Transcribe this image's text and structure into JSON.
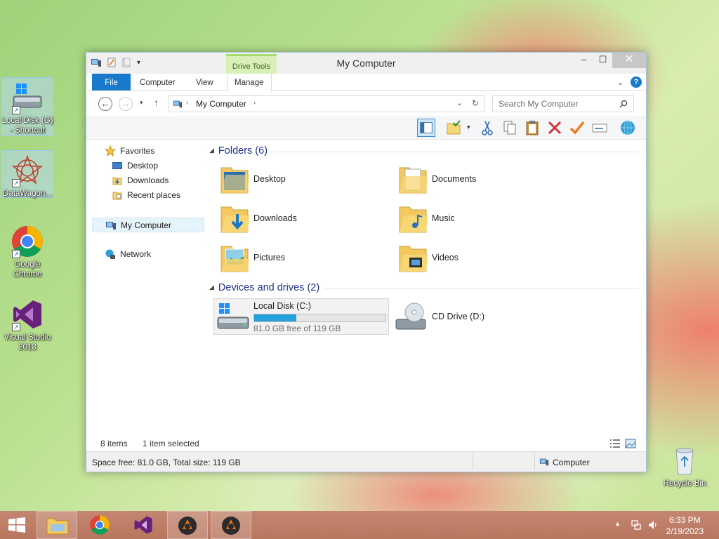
{
  "desktop": {
    "icons": [
      {
        "label_line1": "Local Disk (G)",
        "label_line2": "- Shortcut"
      },
      {
        "label_line1": "DataWagon...",
        "label_line2": ""
      },
      {
        "label_line1": "Google",
        "label_line2": "Chrome"
      },
      {
        "label_line1": "Visual Studio",
        "label_line2": "2013"
      },
      {
        "label_line1": "Recycle Bin",
        "label_line2": ""
      }
    ]
  },
  "window": {
    "title": "My Computer",
    "context_tab": "Drive Tools",
    "controls": {
      "minimize": "–",
      "maximize": "☐",
      "close": "✕"
    },
    "tabs": [
      {
        "label": "File"
      },
      {
        "label": "Computer"
      },
      {
        "label": "View"
      },
      {
        "label": "Manage"
      }
    ],
    "help": "?",
    "address": {
      "path": "My Computer"
    },
    "search": {
      "placeholder": "Search My Computer"
    },
    "nav": {
      "favorites": "Favorites",
      "items": [
        {
          "label": "Desktop"
        },
        {
          "label": "Downloads"
        },
        {
          "label": "Recent places"
        }
      ],
      "my_computer": "My Computer",
      "network": "Network"
    },
    "folders": {
      "heading": "Folders (6)",
      "items": [
        {
          "name": "Desktop"
        },
        {
          "name": "Documents"
        },
        {
          "name": "Downloads"
        },
        {
          "name": "Music"
        },
        {
          "name": "Pictures"
        },
        {
          "name": "Videos"
        }
      ]
    },
    "devices": {
      "heading": "Devices and drives (2)",
      "local_disk": {
        "name": "Local Disk (C:)",
        "free_text": "81.0 GB free of 119 GB",
        "used_fraction": 0.32
      },
      "cd_drive": {
        "name": "CD Drive (D:)"
      }
    },
    "status": {
      "items": "8 items",
      "selected": "1 item selected",
      "space": "Space free: 81.0 GB, Total size: 119 GB",
      "location": "Computer"
    }
  },
  "taskbar": {
    "time": "6:33 PM",
    "date": "2/19/2023"
  },
  "colors": {
    "accent": "#1979ca",
    "drive_bar": "#26a0da",
    "drive_tools_bg": "#d8f0b8",
    "taskbar": "#be7f68"
  }
}
